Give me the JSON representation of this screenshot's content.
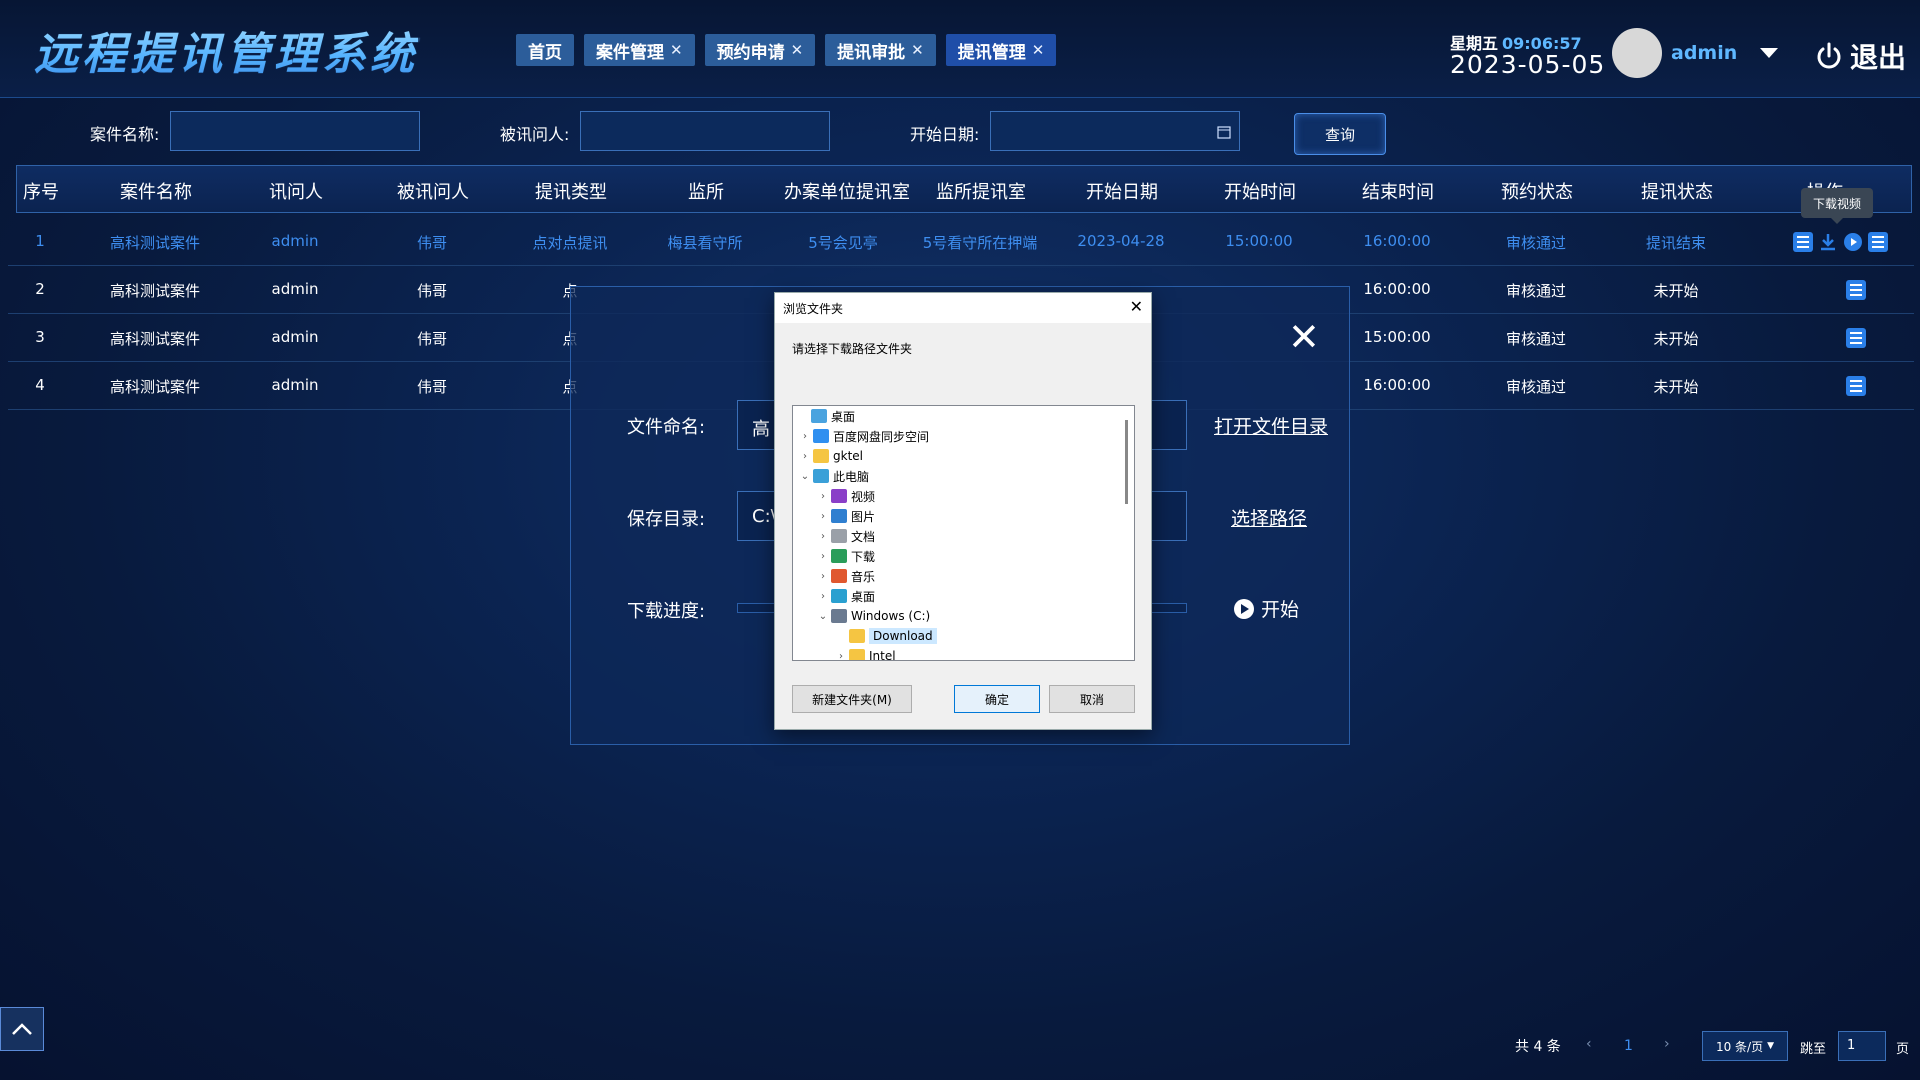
{
  "header": {
    "title": "远程提讯管理系统",
    "weekday": "星期五",
    "time": "09:06:57",
    "date": "2023-05-05",
    "user": "admin",
    "logout": "退出",
    "tabs": [
      {
        "label": "首页",
        "closable": false
      },
      {
        "label": "案件管理",
        "closable": true
      },
      {
        "label": "预约申请",
        "closable": true
      },
      {
        "label": "提讯审批",
        "closable": true
      },
      {
        "label": "提讯管理",
        "closable": true,
        "active": true
      }
    ],
    "close_glyph": "✕"
  },
  "filters": {
    "case_name_label": "案件名称:",
    "interrogatee_label": "被讯问人:",
    "start_date_label": "开始日期:",
    "query_button": "查询"
  },
  "table": {
    "columns": [
      "序号",
      "案件名称",
      "讯问人",
      "被讯问人",
      "提讯类型",
      "监所",
      "办案单位提讯室",
      "监所提讯室",
      "开始日期",
      "开始时间",
      "结束时间",
      "预约状态",
      "提讯状态",
      "操作"
    ],
    "rows": [
      {
        "no": "1",
        "case": "高科测试案件",
        "interrogator": "admin",
        "interrogatee": "伟哥",
        "type": "点对点提讯",
        "prison": "梅县看守所",
        "office_room": "5号会见亭",
        "prison_room": "5号看守所在押端",
        "start_date": "2023-04-28",
        "start_time": "15:00:00",
        "end_time": "16:00:00",
        "appt_status": "审核通过",
        "status": "提讯结束"
      },
      {
        "no": "2",
        "case": "高科测试案件",
        "interrogator": "admin",
        "interrogatee": "伟哥",
        "type": "点",
        "prison": "",
        "office_room": "",
        "prison_room": "",
        "start_date": "",
        "start_time": "",
        "end_time": "16:00:00",
        "appt_status": "审核通过",
        "status": "未开始"
      },
      {
        "no": "3",
        "case": "高科测试案件",
        "interrogator": "admin",
        "interrogatee": "伟哥",
        "type": "点",
        "prison": "",
        "office_room": "",
        "prison_room": "",
        "start_date": "",
        "start_time": "",
        "end_time": "15:00:00",
        "appt_status": "审核通过",
        "status": "未开始"
      },
      {
        "no": "4",
        "case": "高科测试案件",
        "interrogator": "admin",
        "interrogatee": "伟哥",
        "type": "点",
        "prison": "",
        "office_room": "",
        "prison_room": "",
        "start_date": "",
        "start_time": "",
        "end_time": "16:00:00",
        "appt_status": "审核通过",
        "status": "未开始"
      }
    ],
    "tooltip": "下载视频"
  },
  "download_panel": {
    "file_name_label": "文件命名:",
    "file_name_value": "高",
    "save_dir_label": "保存目录:",
    "save_dir_value": "C:\\",
    "progress_label": "下载进度:",
    "open_dir_link": "打开文件目录",
    "choose_path_link": "选择路径",
    "start_button": "开始"
  },
  "folder_dialog": {
    "title": "浏览文件夹",
    "prompt": "请选择下载路径文件夹",
    "tree": [
      {
        "label": "桌面",
        "level": 0,
        "arrow": "",
        "icon": "#4aa3df"
      },
      {
        "label": "百度网盘同步空间",
        "level": 1,
        "arrow": "›",
        "icon": "#2f8ff0"
      },
      {
        "label": "gktel",
        "level": 1,
        "arrow": "›",
        "icon": "#f5c542"
      },
      {
        "label": "此电脑",
        "level": 1,
        "arrow": "⌄",
        "icon": "#3aa0d8"
      },
      {
        "label": "视频",
        "level": 2,
        "arrow": "›",
        "icon": "#8a3fc8"
      },
      {
        "label": "图片",
        "level": 2,
        "arrow": "›",
        "icon": "#2f7fd0"
      },
      {
        "label": "文档",
        "level": 2,
        "arrow": "›",
        "icon": "#9aa0a8"
      },
      {
        "label": "下载",
        "level": 2,
        "arrow": "›",
        "icon": "#2a9d5a"
      },
      {
        "label": "音乐",
        "level": 2,
        "arrow": "›",
        "icon": "#e0582f"
      },
      {
        "label": "桌面",
        "level": 2,
        "arrow": "›",
        "icon": "#2aa0d0"
      },
      {
        "label": "Windows (C:)",
        "level": 2,
        "arrow": "⌄",
        "icon": "#6a7a90"
      },
      {
        "label": "Download",
        "level": 3,
        "arrow": "",
        "icon": "#f5c542",
        "selected": true
      },
      {
        "label": "Intel",
        "level": 3,
        "arrow": "›",
        "icon": "#f5c542"
      }
    ],
    "new_folder": "新建文件夹(M)",
    "ok": "确定",
    "cancel": "取消"
  },
  "pagination": {
    "total": "共 4 条",
    "prev": "‹",
    "page": "1",
    "next": "›",
    "page_size": "10 条/页",
    "jump_label": "跳至",
    "jump_value": "1",
    "page_suffix": "页"
  }
}
